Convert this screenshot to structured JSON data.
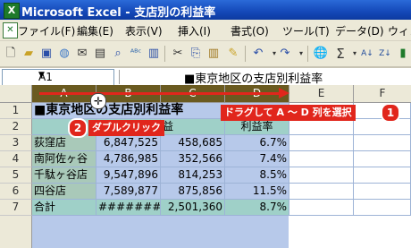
{
  "window": {
    "title": "Microsoft Excel - 支店別の利益率",
    "app_icon": "X"
  },
  "menu": [
    {
      "label": "ファイル(F)"
    },
    {
      "label": "編集(E)"
    },
    {
      "label": "表示(V)"
    },
    {
      "label": "挿入(I)"
    },
    {
      "label": "書式(O)"
    },
    {
      "label": "ツール(T)"
    },
    {
      "label": "データ(D)"
    },
    {
      "label": "ウィン"
    }
  ],
  "formula_bar": {
    "name_box": "A1",
    "content": "■東京地区の支店別利益率"
  },
  "columns": [
    "A",
    "B",
    "C",
    "D",
    "E",
    "F"
  ],
  "rows": [
    "1",
    "2",
    "3",
    "4",
    "5",
    "6",
    "7"
  ],
  "cells": {
    "a1": "■東京地区の支店別利益率",
    "c2": "益",
    "d2": "利益率",
    "a3": "荻窪店",
    "b3": "6,847,525",
    "c3": "458,685",
    "d3": "6.7%",
    "a4": "南阿佐ヶ谷",
    "b4": "4,786,985",
    "c4": "352,566",
    "d4": "7.4%",
    "a5": "千駄ヶ谷店",
    "b5": "9,547,896",
    "c5": "814,253",
    "d5": "8.5%",
    "a6": "四谷店",
    "b6": "7,589,877",
    "c6": "875,856",
    "d6": "11.5%",
    "a7": "合計",
    "b7": "########",
    "c7": "2,501,360",
    "d7": "8.7%"
  },
  "annotations": {
    "step1_number": "1",
    "step1_text": "ドラグして A ～ D 列を選択",
    "step2_number": "2",
    "step2_text": "ダブルクリック"
  },
  "colors": {
    "highlight": "#e1261c",
    "selection": "#b7c9ea",
    "selected_header": "#6a5a20"
  }
}
